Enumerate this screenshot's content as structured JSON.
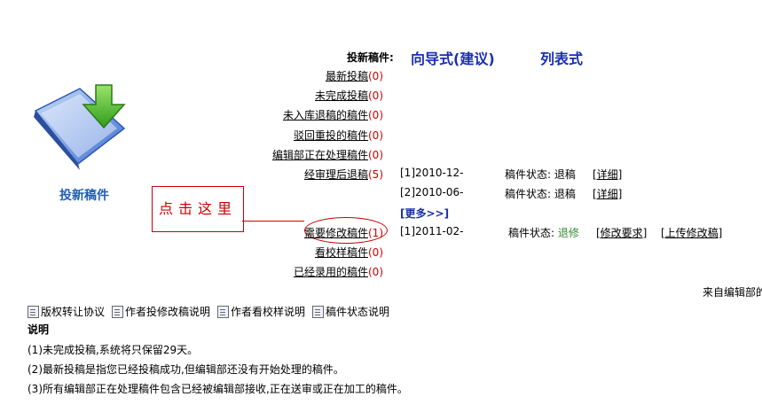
{
  "header": {
    "label": "投新稿件:",
    "mode_wizard": "向导式(建议)",
    "mode_list": "列表式"
  },
  "big_icon": {
    "label": "投新稿件"
  },
  "annotation": {
    "text": "点击这里"
  },
  "items": [
    {
      "label": "最新投稿",
      "count": "(0)"
    },
    {
      "label": "未完成投稿",
      "count": "(0)"
    },
    {
      "label": "未入库退稿的稿件",
      "count": "(0)"
    },
    {
      "label": "驳回重投的稿件",
      "count": "(0)"
    },
    {
      "label": "编辑部正在处理稿件",
      "count": "(0)"
    },
    {
      "label": "经审理后退稿",
      "count": "(5)"
    },
    {
      "label": "需要修改稿件",
      "count": "(1)"
    },
    {
      "label": "看校样稿件",
      "count": "(0)"
    },
    {
      "label": "已经录用的稿件",
      "count": "(0)"
    }
  ],
  "rejected_rows": [
    {
      "id": "[1]2010-12-",
      "status_label": "稿件状态:",
      "status": "退稿",
      "action": "[详细]"
    },
    {
      "id": "[2]2010-06-",
      "status_label": "稿件状态:",
      "status": "退稿",
      "action": "[详细]"
    }
  ],
  "more_label": "[更多>>]",
  "revision_row": {
    "id": "[1]2011-02-",
    "status_label": "稿件状态:",
    "status": "退修",
    "action1": "[修改要求]",
    "action2": "[上传修改稿]"
  },
  "editor_note": "来自编辑部的",
  "bottom_links": [
    "版权转让协议",
    "作者投修改稿说明",
    "作者看校样说明",
    "稿件状态说明"
  ],
  "explain": {
    "title": "说明",
    "lines": [
      "(1)未完成投稿,系统将只保留29天。",
      "(2)最新投稿是指您已经投稿成功,但编辑部还没有开始处理的稿件。",
      "(3)所有编辑部正在处理稿件包含已经被编辑部接收,正在送审或正在加工的稿件。"
    ]
  },
  "colors": {
    "count": "#d00000",
    "mode": "#1a2fb0",
    "status_revise": "#2e8b2e",
    "annotation": "#cc0000"
  }
}
